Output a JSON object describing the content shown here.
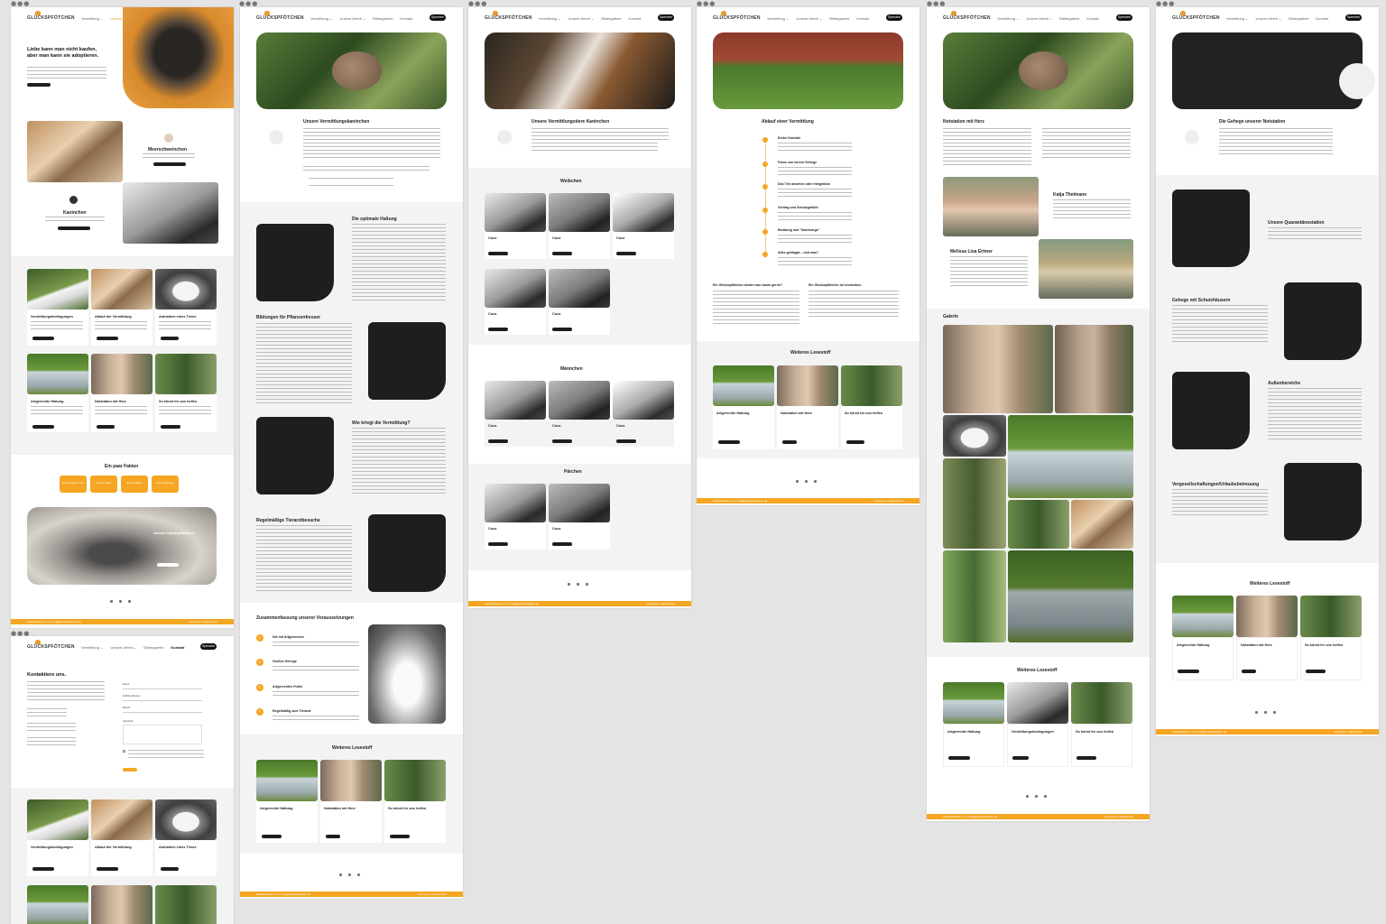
{
  "brand": {
    "logo_text": "GLÜCKSPFÖTCHEN",
    "accent": "#f5a623",
    "dark": "#1e1e1e"
  },
  "nav": {
    "items": [
      "Vermittlung ⌄",
      "Unsere Arbeit ⌄",
      "Bildergalerie",
      "Kontakt"
    ],
    "button": "Spenden"
  },
  "home": {
    "hero_title": "Liebe kann man nicht kaufen, aber man kann sie adoptieren.",
    "meerschweinchen_title": "Meerschweinchen",
    "kaninchen_title": "Kaninchen",
    "cards": [
      "Vermittlungsbedingungen",
      "Ablauf der Vermittlung",
      "Aufnahme eines Tieres",
      "Artgerechte Haltung",
      "Notstation mit Herz",
      "So könnt ihr uns helfen"
    ],
    "facts_title": "Ein paar Fakten",
    "facts": [
      "Vermittlungen im Jahr",
      "Tiere in Pflege",
      "Ehrenamtliche",
      "Jahre Erfahrung"
    ],
    "intro_banner_title": "Unsere Glückspfötchen"
  },
  "contact": {
    "title": "Kontaktiere uns.",
    "fields": [
      "Name",
      "E-Mail-Adresse",
      "Betreff",
      "Nachricht"
    ]
  },
  "page_kaninchen": {
    "title": "Unsere Vermittlungskaninchen",
    "sec1": "Die optimale Haltung",
    "sec2": "Bildungen für Pflanzenfresser",
    "sec3": "Wie kriegt die Vermittlung?",
    "sec4": "Regelmäßige Tierarztbesuche",
    "summary": "Zusammenfassung unserer Voraussetzungen",
    "checks": [
      "Nie mit Artgenossen",
      "Großes Gehege",
      "Artgerechtes Futter",
      "Regelmäßig zum Tierarzt"
    ],
    "more": "Weiteres Lesestoff",
    "more_cards": [
      "Artgerechte Haltung",
      "Notstation mit Herz",
      "So könnt ihr uns helfen"
    ]
  },
  "page_vermittlung": {
    "title": "Unsere Vermittlungstiere Kaninchen",
    "groups": [
      "Weibchen",
      "Männchen",
      "Pärchen"
    ],
    "animal_name": "Coco"
  },
  "page_ablauf": {
    "title": "Ablauf einer Vermittlung",
    "steps": [
      "Erster Kontakt",
      "Fotos von eurem Gehege",
      "Das Tier ansehen oder Integration",
      "Vertrag und Schutzgebühr",
      "Beratung und \"Nachsorge\"",
      "Alles geklappt – und was?"
    ],
    "col1": "Ein Glückspfötchen würde man kaum gerne?",
    "col2": "Ein Glückspfötchen ist verstorben",
    "more": "Weiteres Lesestoff"
  },
  "page_notstation": {
    "title": "Notstation mit Herz",
    "person1": "Katja Thelmann",
    "person2": "Melissa Lisa Ertmer",
    "gallery": "Galerie",
    "more": "Weiteres Lesestoff",
    "more_cards": [
      "Artgerechte Haltung",
      "Vermittlungsbedingungen",
      "So könnt ihr uns helfen"
    ]
  },
  "page_gehege": {
    "title": "Die Gehege unserer Notstation",
    "sec1": "Unsere Quarantänestation",
    "sec2": "Gehege mit Schutzhäusern",
    "sec3": "Außenbereiche",
    "sec4": "Vergesellschaftungen/Urlaubsbetreuung",
    "more": "Weiteres Lesestoff",
    "more_cards": [
      "Artgerechte Haltung",
      "Notstation mit Herz",
      "So könnt ihr uns helfen"
    ]
  },
  "footer": {
    "left": "Glückspfötchen e.V. | info@glueckspfoetchen.de",
    "right": "Impressum | Datenschutz"
  }
}
